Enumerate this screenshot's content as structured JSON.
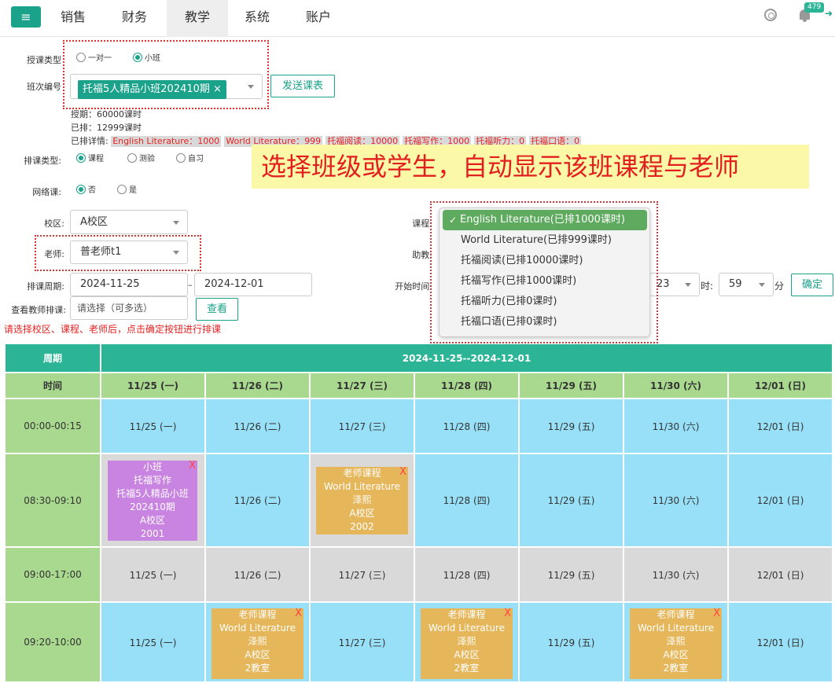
{
  "nav": {
    "menu_icon": "hamburger-icon",
    "items": [
      "销售",
      "财务",
      "教学",
      "系统",
      "账户"
    ],
    "active": "教学",
    "badge": "479"
  },
  "form": {
    "teach_type_label": "授课类型",
    "teach_type_options": [
      "一对一",
      "小班"
    ],
    "teach_type_selected": "小班",
    "class_no_label": "班次编号",
    "class_tag": "托福5人精品小班202410期",
    "send_btn": "发送课表",
    "info_lines": [
      "授期：60000课时",
      "已排：12999课时"
    ],
    "detail_label": "已排详情:",
    "detail_tags": [
      "English Literature：1000",
      "World Literature：999",
      "托福阅读：10000",
      "托福写作：1000",
      "托福听力：0",
      "托福口语：0"
    ],
    "sched_type_label": "排课类型:",
    "sched_type_options": [
      "课程",
      "测验",
      "自习"
    ],
    "sched_type_selected": "课程",
    "online_label": "网络课:",
    "online_options": [
      "否",
      "是"
    ],
    "online_selected": "否",
    "campus_label": "校区:",
    "campus_value": "A校区",
    "teacher_label": "老师:",
    "teacher_value": "普老师t1",
    "course_label": "课程:",
    "assistant_label": "助教:",
    "period_label": "排课周期:",
    "period_start": "2024-11-25",
    "period_sep": "–",
    "period_end": "2024-12-01",
    "start_time_label": "开始时间:",
    "hour_value": "23",
    "hour_unit": "时:",
    "minute_value": "59",
    "minute_unit": "分",
    "confirm_btn": "确定",
    "view_teacher_label": "查看教师排课:",
    "view_teacher_placeholder": "请选择（可多选）",
    "view_btn": "查看",
    "note": "请选择校区、课程、老师后，点击确定按钮进行排课"
  },
  "callout": "选择班级或学生，自动显示该班课程与老师",
  "course_dropdown": {
    "options": [
      "English Literature(已排1000课时)",
      "World Literature(已排999课时)",
      "托福阅读(已排10000课时)",
      "托福写作(已排1000课时)",
      "托福听力(已排0课时)",
      "托福口语(已排0课时)"
    ],
    "selected": "English Literature(已排1000课时)"
  },
  "schedule": {
    "week_label": "周期",
    "range": "2024-11-25--2024-12-01",
    "time_label": "时间",
    "days": [
      "11/25 (一)",
      "11/26 (二)",
      "11/27 (三)",
      "11/28 (四)",
      "11/29 (五)",
      "11/30 (六)",
      "12/01 (日)"
    ],
    "rows": [
      {
        "time": "00:00-00:15",
        "cells": [
          "11/25 (一)",
          "11/26 (二)",
          "11/27 (三)",
          "11/28 (四)",
          "11/29 (五)",
          "11/30 (六)",
          "12/01 (日)"
        ]
      },
      {
        "time": "08:30-09:10",
        "cells": [
          "",
          "11/26 (二)",
          "",
          "11/28 (四)",
          "11/29 (五)",
          "11/30 (六)",
          "12/01 (日)"
        ]
      },
      {
        "time": "09:00-17:00",
        "cells": [
          "11/25 (一)",
          "11/26 (二)",
          "11/27 (三)",
          "11/28 (四)",
          "11/29 (五)",
          "11/30 (六)",
          "12/01 (日)"
        ]
      },
      {
        "time": "09:20-10:00",
        "cells": [
          "11/25 (一)",
          "",
          "11/27 (三)",
          "",
          "11/29 (五)",
          "",
          "12/01 (日)"
        ]
      }
    ],
    "cards": {
      "r2c1": [
        "小班",
        "托福写作",
        "托福5人精品小班",
        "202410期",
        "A校区",
        "2001"
      ],
      "r2c3": [
        "老师课程",
        "World Literature",
        "泽熙",
        "A校区",
        "2002"
      ],
      "r4c2": [
        "老师课程",
        "World Literature",
        "泽熙",
        "A校区",
        "2教室"
      ],
      "r4c4": [
        "老师课程",
        "World Literature",
        "泽熙",
        "A校区",
        "2教室"
      ],
      "r4c6": [
        "老师课程",
        "World Literature",
        "泽熙",
        "A校区",
        "2教室"
      ]
    },
    "card_close": "X"
  },
  "colors": {
    "accent": "#1aa28a",
    "header": "#2bb596",
    "time_cell": "#a9d98e",
    "slot_blue": "#97e0f7",
    "slot_gray": "#d9d9d9",
    "card_purple": "#c884e0",
    "card_gold": "#e6b65a",
    "alert": "#e52222"
  }
}
